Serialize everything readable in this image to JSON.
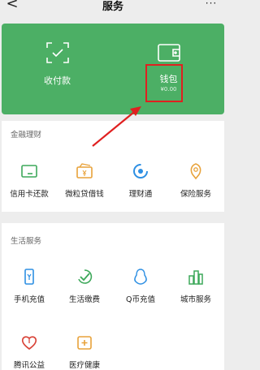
{
  "nav": {
    "title": "服务",
    "back": "<",
    "more": "···"
  },
  "top": {
    "pay": {
      "label": "收付款"
    },
    "wallet": {
      "label": "钱包",
      "balance": "¥0.00"
    }
  },
  "finance": {
    "title": "金融理财",
    "items": [
      {
        "label": "信用卡还款",
        "icon": "credit-card-icon"
      },
      {
        "label": "微粒贷借钱",
        "icon": "loan-wallet-icon"
      },
      {
        "label": "理财通",
        "icon": "wealth-icon"
      },
      {
        "label": "保险服务",
        "icon": "insurance-icon"
      }
    ]
  },
  "life": {
    "title": "生活服务",
    "items": [
      {
        "label": "手机充值",
        "icon": "phone-icon"
      },
      {
        "label": "生活缴费",
        "icon": "bill-pay-icon"
      },
      {
        "label": "Q币充值",
        "icon": "penguin-icon"
      },
      {
        "label": "城市服务",
        "icon": "city-icon"
      },
      {
        "label": "腾讯公益",
        "icon": "charity-heart-icon"
      },
      {
        "label": "医疗健康",
        "icon": "medical-icon"
      }
    ]
  },
  "colors": {
    "green": "#4caf65",
    "highlight": "#e02020",
    "finance_green": "#3da85a",
    "orange": "#e8a23a",
    "blue": "#2d8fe3",
    "red": "#d9453a"
  }
}
